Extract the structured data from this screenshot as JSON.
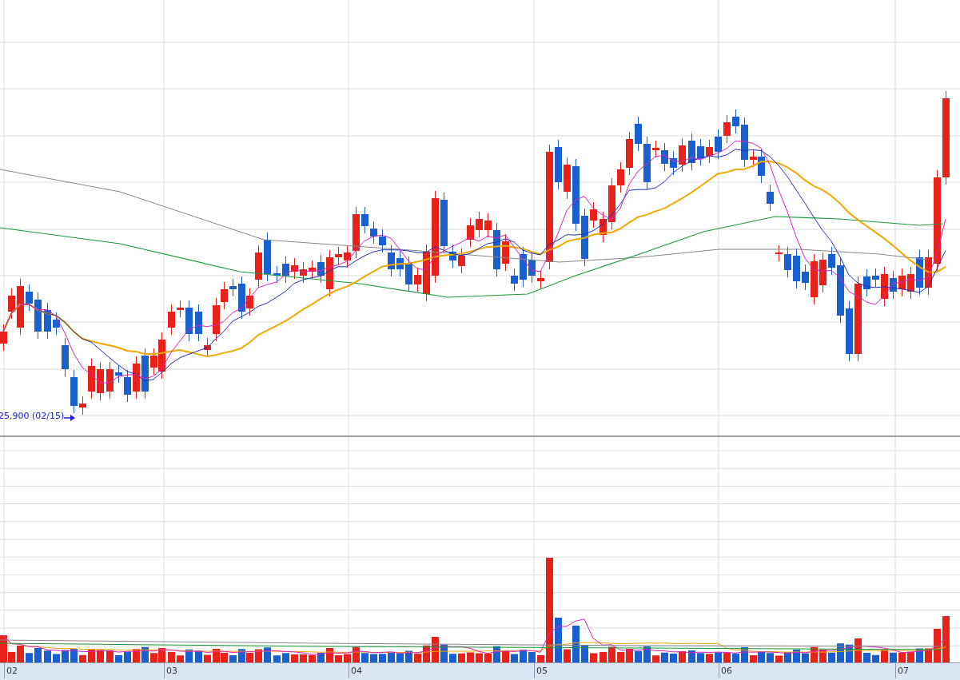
{
  "price_panel": {
    "low_marker": "25,900 (02/15)"
  },
  "x_axis": {
    "labels": [
      "02",
      "03",
      "04",
      "05",
      "06",
      "07"
    ]
  }
}
